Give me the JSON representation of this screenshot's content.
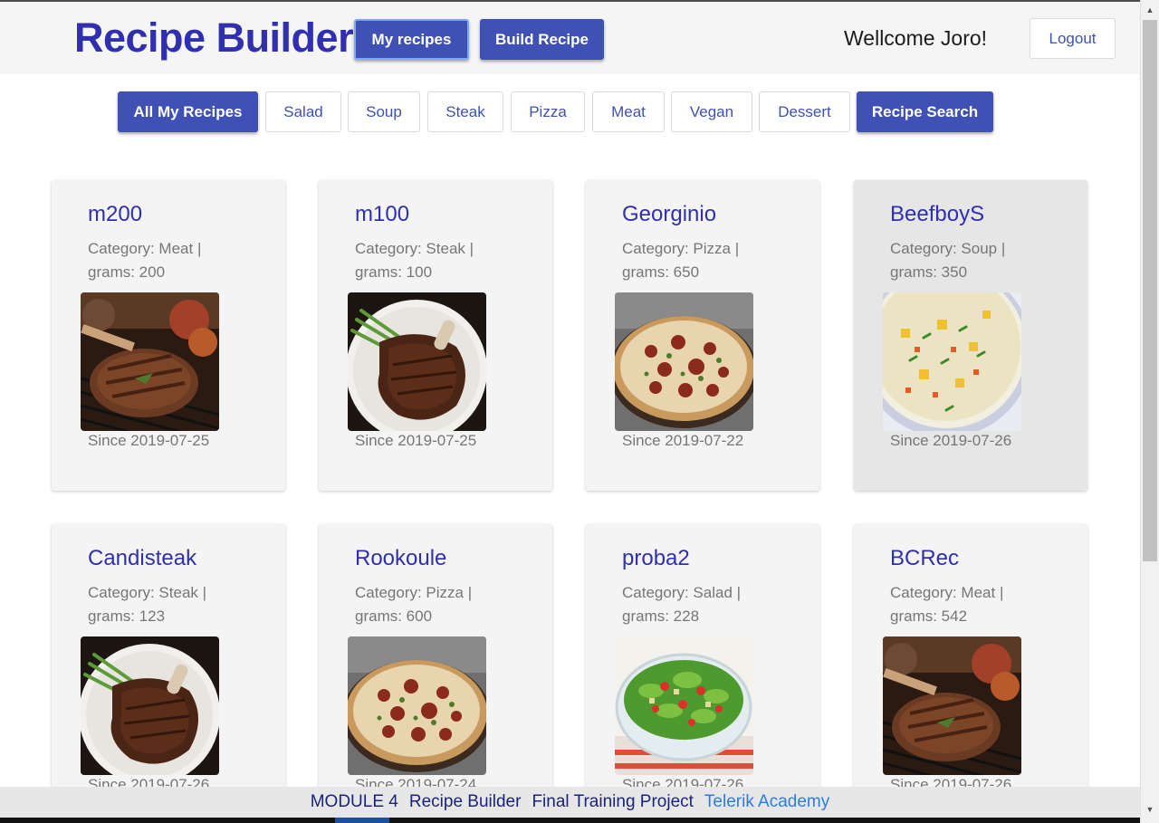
{
  "header": {
    "title": "Recipe Builder",
    "my_recipes_label": "My recipes",
    "build_recipe_label": "Build Recipe",
    "welcome_text": "Wellcome Joro!",
    "logout_label": "Logout"
  },
  "filters": {
    "all_label": "All My Recipes",
    "salad_label": "Salad",
    "soup_label": "Soup",
    "steak_label": "Steak",
    "pizza_label": "Pizza",
    "meat_label": "Meat",
    "vegan_label": "Vegan",
    "dessert_label": "Dessert",
    "search_label": "Recipe Search"
  },
  "recipes": [
    {
      "name": "m200",
      "category_line": "Category: Meat |",
      "grams_line": "grams: 200",
      "since": "Since 2019-07-25",
      "image": "grilled-steak-image"
    },
    {
      "name": "m100",
      "category_line": "Category: Steak |",
      "grams_line": "grams: 100",
      "since": "Since 2019-07-25",
      "image": "plated-steak-image"
    },
    {
      "name": "Georginio",
      "category_line": "Category: Pizza |",
      "grams_line": "grams: 650",
      "since": "Since 2019-07-22",
      "image": "pizza-image"
    },
    {
      "name": "BeefboyS",
      "category_line": "Category: Soup |",
      "grams_line": "grams: 350",
      "since": "Since 2019-07-26",
      "image": "soup-image"
    },
    {
      "name": "Candisteak",
      "category_line": "Category: Steak |",
      "grams_line": "grams: 123",
      "since": "Since 2019-07-26",
      "image": "plated-steak-image"
    },
    {
      "name": "Rookoule",
      "category_line": "Category: Pizza |",
      "grams_line": "grams: 600",
      "since": "Since 2019-07-24",
      "image": "pizza-image"
    },
    {
      "name": "proba2",
      "category_line": "Category: Salad |",
      "grams_line": "grams: 228",
      "since": "Since 2019-07-26",
      "image": "salad-image"
    },
    {
      "name": "BCRec",
      "category_line": "Category: Meat |",
      "grams_line": "grams: 542",
      "since": "Since 2019-07-26",
      "image": "grilled-steak-image"
    }
  ],
  "footer": {
    "module": "MODULE 4",
    "app": "Recipe Builder",
    "project": "Final Training Project",
    "academy": "Telerik Academy"
  },
  "colors": {
    "accent": "#3f51b5",
    "title": "#2f2fb0",
    "card_bg": "#f4f4f4",
    "card_hover_bg": "#e6e6e6",
    "footer_link": "#2c7be5"
  }
}
